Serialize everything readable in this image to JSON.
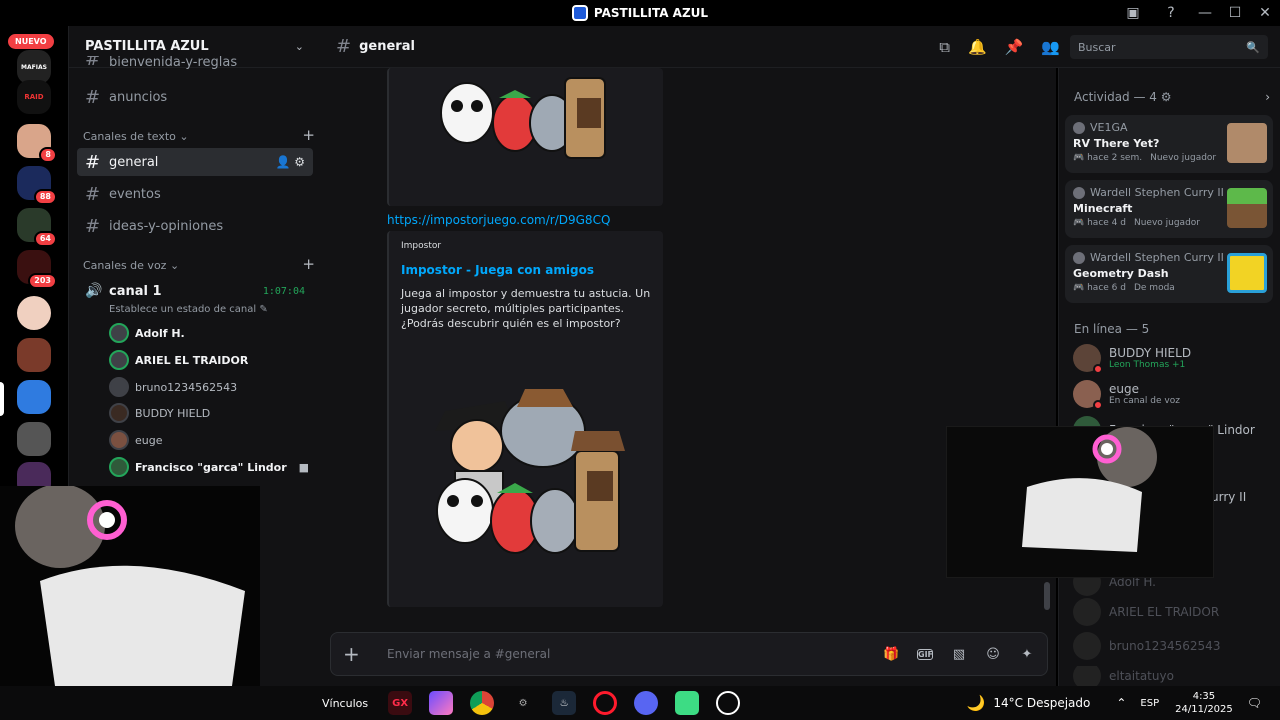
{
  "window": {
    "title": "PASTILLITA AZUL"
  },
  "rail": {
    "nuevo_label": "NUEVO",
    "badges": [
      "8",
      "88",
      "64",
      "203"
    ]
  },
  "server": {
    "name": "PASTILLITA AZUL"
  },
  "sidebar": {
    "cutoff_channel": "bienvenida-y-reglas",
    "announcements": "anuncios",
    "text_category": "Canales de texto",
    "text_channels": [
      "general",
      "eventos",
      "ideas-y-opiniones"
    ],
    "voice_category": "Canales de voz",
    "voice_channel": {
      "name": "canal 1",
      "timer": "1:07:04",
      "status_hint": "Establece un estado de canal"
    },
    "voice_users": [
      "Adolf H.",
      "ARIEL EL TRAIDOR",
      "bruno1234562543",
      "BUDDY HIELD",
      "euge",
      "Francisco \"garca\" Lindor"
    ]
  },
  "header": {
    "channel": "general",
    "search_placeholder": "Buscar"
  },
  "messages": {
    "link": "https://impostorjuego.com/r/D9G8CQ",
    "embed": {
      "site": "Impostor",
      "title": "Impostor - Juega con amigos",
      "description": "Juega al impostor y demuestra tu astucia. Un jugador secreto, múltiples participantes. ¿Podrás descubrir quién es el impostor?"
    }
  },
  "composer": {
    "placeholder": "Enviar mensaje a #general"
  },
  "activity": {
    "title": "Actividad — 4",
    "cards": [
      {
        "user": "VE1GA",
        "game": "RV There Yet?",
        "time": "hace 2 sem.",
        "tag": "Nuevo jugador"
      },
      {
        "user": "Wardell Stephen Curry II",
        "game": "Minecraft",
        "time": "hace 4 d",
        "tag": "Nuevo jugador"
      },
      {
        "user": "Wardell Stephen Curry II",
        "game": "Geometry Dash",
        "time": "hace 6 d",
        "tag": "De moda"
      }
    ]
  },
  "online": {
    "title": "En línea — 5",
    "members": [
      {
        "name": "BUDDY HIELD",
        "status": "Leon Thomas +1"
      },
      {
        "name": "euge",
        "status": "En canal de voz"
      },
      {
        "name": "Francisco \"garca\" Lindor",
        "status": ""
      }
    ],
    "partial_name": "urry II",
    "offline": [
      "Adolf H.",
      "ARIEL EL TRAIDOR",
      "bruno1234562543",
      "eltaitatuyo"
    ]
  },
  "taskbar": {
    "links": "Vínculos",
    "weather": "14°C Despejado",
    "lang": "ESP",
    "time": "4:35",
    "date": "24/11/2025"
  }
}
